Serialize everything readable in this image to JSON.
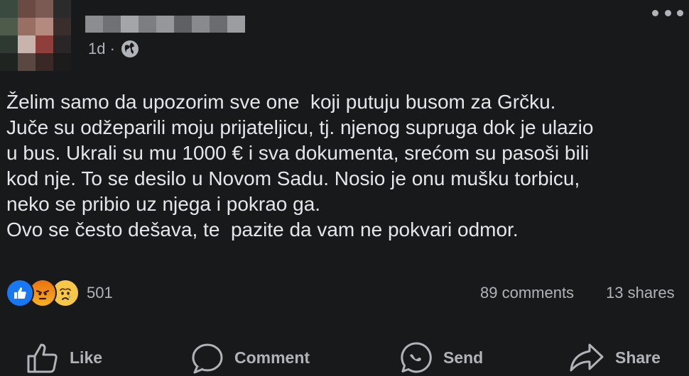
{
  "post": {
    "time": "1d ·",
    "privacy_icon": "globe-icon",
    "text_lines": [
      "Želim samo da upozorim sve one  koji putuju busom za Grčku.",
      "Juče su odžeparili moju prijateljicu, tj. njenog supruga dok je ulazio",
      "u bus. Ukrali su mu 1000 € i sva dokumenta, srećom su pasoši bili",
      "kod nje. To se desilo u Novom Sadu. Nosio je onu mušku torbicu,",
      "neko se pribio uz njega i pokrao ga.",
      "Ovo se često dešava, te  pazite da vam ne pokvari odmor."
    ]
  },
  "stats": {
    "reaction_icons": [
      "like-icon",
      "angry-icon",
      "sad-icon"
    ],
    "reactions": "501",
    "comments": "89 comments",
    "shares": "13 shares"
  },
  "actions": {
    "like": "Like",
    "comment": "Comment",
    "send": "Send",
    "share": "Share"
  },
  "colors": {
    "background": "#18191a",
    "text": "#e4e6eb",
    "secondary_text": "#b0b3b8",
    "like_blue": "#1877f2"
  }
}
